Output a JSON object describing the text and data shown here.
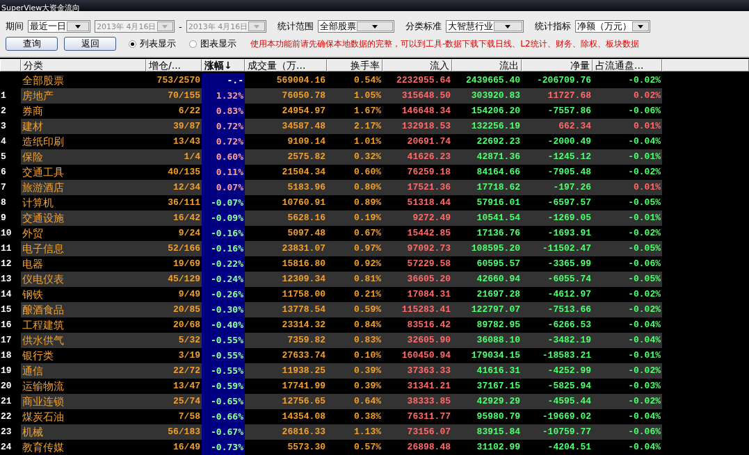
{
  "window": {
    "title": "SuperView大资金流向"
  },
  "filters": [
    {
      "label": "期间",
      "value": "最近一日",
      "disabled": false
    },
    {
      "value": "2013年  4月16日",
      "disabled": true
    },
    {
      "separator": "-",
      "value": "2013年  4月16日",
      "disabled": true
    },
    {
      "label": "统计范围",
      "value": "全部股票",
      "disabled": false
    },
    {
      "label": "分类标准",
      "value": "大智慧行业",
      "disabled": false
    },
    {
      "label": "统计指标",
      "value": "净额（万元）",
      "disabled": false
    }
  ],
  "buttons": [
    "查询",
    "返回"
  ],
  "views": [
    {
      "label": "列表显示",
      "selected": true
    },
    {
      "label": "图表显示",
      "selected": false
    }
  ],
  "notice": "使用本功能前请先确保本地数据的完整，可以到工具-数据下载下载日线、L2统计、财务、除权、板块数据",
  "table": {
    "columns": [
      {
        "label": "分类",
        "sorted": false
      },
      {
        "label": "增仓/...",
        "sorted": false
      },
      {
        "label": "涨幅↓",
        "sorted": true
      },
      {
        "label": "成交量（万...",
        "sorted": false
      },
      {
        "label": "换手率",
        "sorted": false
      },
      {
        "label": "流入",
        "sorted": false
      },
      {
        "label": "流出",
        "sorted": false
      },
      {
        "label": "净量",
        "sorted": false
      },
      {
        "label": "占流通盘...",
        "sorted": false
      }
    ],
    "rows": [
      {
        "name": "全部股票",
        "ratio": "753/2570",
        "change": "-.-",
        "volume": "569004.16",
        "turnover": "0.54%",
        "inflow": "2232955.64",
        "outflow": "2439665.40",
        "net": "-206709.76",
        "share": "-0.02%"
      },
      {
        "index": "1",
        "name": "房地产",
        "ratio": "70/155",
        "change": "1.32%",
        "volume": "76050.78",
        "turnover": "1.05%",
        "inflow": "315648.50",
        "outflow": "303920.83",
        "net": "11727.68",
        "share": "0.02%"
      },
      {
        "index": "2",
        "name": "券商",
        "ratio": "6/22",
        "change": "0.83%",
        "volume": "24954.97",
        "turnover": "1.67%",
        "inflow": "146648.34",
        "outflow": "154206.20",
        "net": "-7557.86",
        "share": "-0.06%"
      },
      {
        "index": "3",
        "name": "建材",
        "ratio": "39/87",
        "change": "0.72%",
        "volume": "34587.48",
        "turnover": "2.17%",
        "inflow": "132918.53",
        "outflow": "132256.19",
        "net": "662.34",
        "share": "0.01%"
      },
      {
        "index": "4",
        "name": "造纸印刷",
        "ratio": "13/43",
        "change": "0.72%",
        "volume": "9109.14",
        "turnover": "1.01%",
        "inflow": "20691.74",
        "outflow": "22692.23",
        "net": "-2000.49",
        "share": "-0.04%"
      },
      {
        "index": "5",
        "name": "保险",
        "ratio": "1/4",
        "change": "0.60%",
        "volume": "2575.82",
        "turnover": "0.32%",
        "inflow": "41626.23",
        "outflow": "42871.36",
        "net": "-1245.12",
        "share": "-0.01%"
      },
      {
        "index": "6",
        "name": "交通工具",
        "ratio": "40/135",
        "change": "0.11%",
        "volume": "21504.34",
        "turnover": "0.60%",
        "inflow": "76259.18",
        "outflow": "84164.66",
        "net": "-7905.48",
        "share": "-0.02%"
      },
      {
        "index": "7",
        "name": "旅游酒店",
        "ratio": "12/34",
        "change": "0.07%",
        "volume": "5183.96",
        "turnover": "0.80%",
        "inflow": "17521.36",
        "outflow": "17718.62",
        "net": "-197.26",
        "share": "0.01%"
      },
      {
        "index": "8",
        "name": "计算机",
        "ratio": "36/111",
        "change": "-0.07%",
        "volume": "10760.91",
        "turnover": "0.89%",
        "inflow": "51318.44",
        "outflow": "57916.01",
        "net": "-6597.57",
        "share": "-0.05%"
      },
      {
        "index": "9",
        "name": "交通设施",
        "ratio": "16/42",
        "change": "-0.09%",
        "volume": "5628.16",
        "turnover": "0.19%",
        "inflow": "9272.49",
        "outflow": "10541.54",
        "net": "-1269.05",
        "share": "-0.01%"
      },
      {
        "index": "10",
        "name": "外贸",
        "ratio": "9/24",
        "change": "-0.16%",
        "volume": "5097.48",
        "turnover": "0.67%",
        "inflow": "15442.85",
        "outflow": "17136.76",
        "net": "-1693.91",
        "share": "-0.02%"
      },
      {
        "index": "11",
        "name": "电子信息",
        "ratio": "52/166",
        "change": "-0.16%",
        "volume": "23831.07",
        "turnover": "0.97%",
        "inflow": "97092.73",
        "outflow": "108595.20",
        "net": "-11502.47",
        "share": "-0.05%"
      },
      {
        "index": "12",
        "name": "电器",
        "ratio": "19/69",
        "change": "-0.22%",
        "volume": "15816.80",
        "turnover": "0.92%",
        "inflow": "57229.58",
        "outflow": "60595.57",
        "net": "-3365.99",
        "share": "-0.06%"
      },
      {
        "index": "13",
        "name": "仪电仪表",
        "ratio": "45/129",
        "change": "-0.24%",
        "volume": "12309.34",
        "turnover": "0.81%",
        "inflow": "36605.20",
        "outflow": "42660.94",
        "net": "-6055.74",
        "share": "-0.05%"
      },
      {
        "index": "14",
        "name": "钢铁",
        "ratio": "9/49",
        "change": "-0.26%",
        "volume": "11758.00",
        "turnover": "0.21%",
        "inflow": "17084.31",
        "outflow": "21697.28",
        "net": "-4612.97",
        "share": "-0.02%"
      },
      {
        "index": "15",
        "name": "酿酒食品",
        "ratio": "20/85",
        "change": "-0.30%",
        "volume": "13778.54",
        "turnover": "0.59%",
        "inflow": "115283.41",
        "outflow": "122797.07",
        "net": "-7513.66",
        "share": "-0.02%"
      },
      {
        "index": "16",
        "name": "工程建筑",
        "ratio": "20/68",
        "change": "-0.40%",
        "volume": "23314.32",
        "turnover": "0.84%",
        "inflow": "83516.42",
        "outflow": "89782.95",
        "net": "-6266.53",
        "share": "-0.04%"
      },
      {
        "index": "17",
        "name": "供水供气",
        "ratio": "5/32",
        "change": "-0.55%",
        "volume": "7359.82",
        "turnover": "0.83%",
        "inflow": "32605.90",
        "outflow": "36088.10",
        "net": "-3482.19",
        "share": "-0.04%"
      },
      {
        "index": "18",
        "name": "银行类",
        "ratio": "3/19",
        "change": "-0.55%",
        "volume": "27633.74",
        "turnover": "0.10%",
        "inflow": "160450.94",
        "outflow": "179034.15",
        "net": "-18583.21",
        "share": "-0.01%"
      },
      {
        "index": "19",
        "name": "通信",
        "ratio": "22/72",
        "change": "-0.55%",
        "volume": "11938.25",
        "turnover": "0.39%",
        "inflow": "37363.33",
        "outflow": "41616.31",
        "net": "-4252.99",
        "share": "-0.02%"
      },
      {
        "index": "20",
        "name": "运输物流",
        "ratio": "13/47",
        "change": "-0.59%",
        "volume": "17741.99",
        "turnover": "0.39%",
        "inflow": "31341.21",
        "outflow": "37167.15",
        "net": "-5825.94",
        "share": "-0.03%"
      },
      {
        "index": "21",
        "name": "商业连锁",
        "ratio": "25/74",
        "change": "-0.65%",
        "volume": "12756.65",
        "turnover": "0.64%",
        "inflow": "38333.85",
        "outflow": "42929.29",
        "net": "-4595.44",
        "share": "-0.02%"
      },
      {
        "index": "22",
        "name": "煤炭石油",
        "ratio": "7/58",
        "change": "-0.66%",
        "volume": "14354.08",
        "turnover": "0.38%",
        "inflow": "76311.77",
        "outflow": "95980.79",
        "net": "-19669.02",
        "share": "-0.04%"
      },
      {
        "index": "23",
        "name": "机械",
        "ratio": "56/183",
        "change": "-0.67%",
        "volume": "26816.33",
        "turnover": "1.13%",
        "inflow": "73156.07",
        "outflow": "83915.84",
        "net": "-10759.77",
        "share": "-0.06%"
      },
      {
        "index": "24",
        "name": "教育传媒",
        "ratio": "16/49",
        "change": "-0.73%",
        "volume": "5573.30",
        "turnover": "0.57%",
        "inflow": "26898.48",
        "outflow": "31102.99",
        "net": "-4204.51",
        "share": "-0.04%"
      }
    ]
  }
}
